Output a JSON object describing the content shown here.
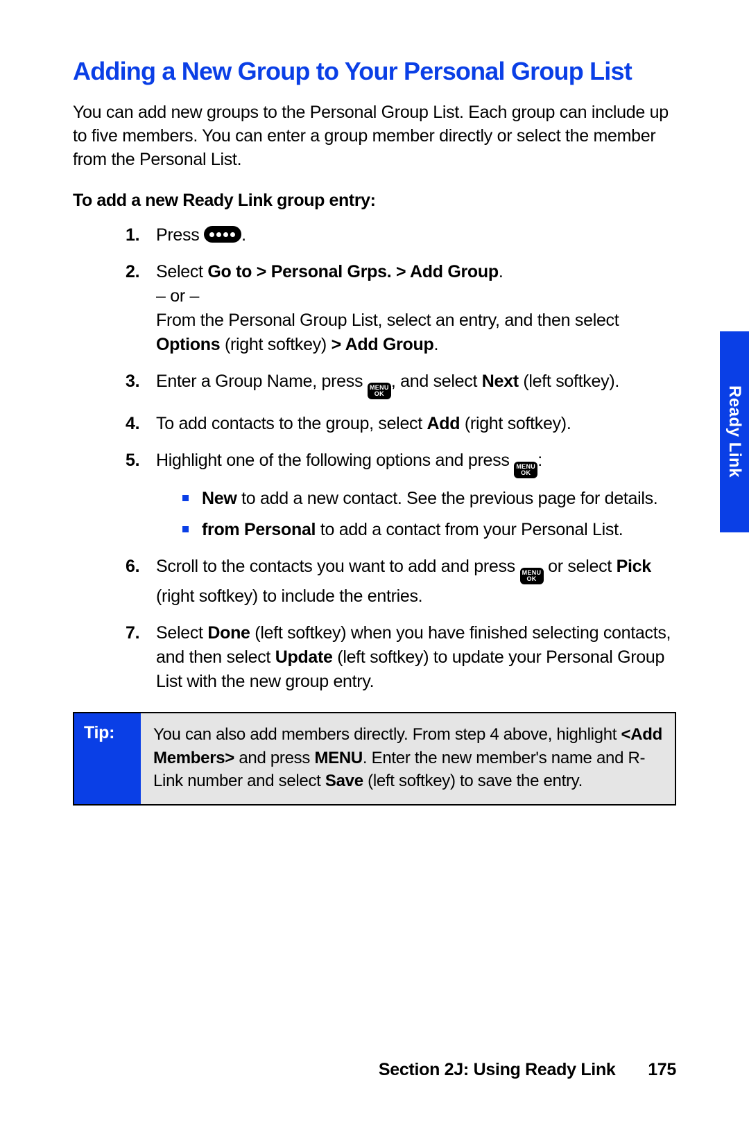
{
  "title": "Adding a New Group to Your Personal Group List",
  "intro": "You can add new groups to the Personal Group List. Each group can include up to five members. You can enter a group member directly or select the member from the Personal List.",
  "subhead": "To add a new Ready Link group entry:",
  "steps": {
    "s1_a": "Press ",
    "s1_b": ".",
    "s2_a": "Select ",
    "s2_b": "Go to > Personal Grps. > Add Group",
    "s2_c": ".",
    "s2_or": "– or –",
    "s2_d1": "From the Personal Group List, select an entry, and then select ",
    "s2_d2": "Options",
    "s2_d3": " (right softkey) ",
    "s2_d4": "> Add Group",
    "s2_d5": ".",
    "s3_a": "Enter a Group Name, press ",
    "s3_b": ", and select ",
    "s3_c": "Next",
    "s3_d": " (left softkey).",
    "s4_a": "To add contacts to the group, select ",
    "s4_b": "Add",
    "s4_c": " (right softkey).",
    "s5_a": "Highlight one of the following options and press ",
    "s5_b": ":",
    "s5_opt1_a": "New",
    "s5_opt1_b": " to add a new contact. See the previous page for details.",
    "s5_opt2_a": "from Personal",
    "s5_opt2_b": " to add a contact from your Personal List.",
    "s6_a": "Scroll to the contacts you want to add and press ",
    "s6_b": " or select ",
    "s6_c": "Pick",
    "s6_d": " (right softkey) to include the entries.",
    "s7_a": "Select ",
    "s7_b": "Done",
    "s7_c": " (left softkey) when you have finished selecting contacts, and then select ",
    "s7_d": "Update",
    "s7_e": " (left softkey) to update your Personal Group List with the new group entry."
  },
  "tip": {
    "label": "Tip:",
    "t1": "You can also add members directly. From step 4 above, highlight ",
    "t2": "<Add Members>",
    "t3": " and press ",
    "t4": "MENU",
    "t5": ". Enter the new member's name and R-Link number and select ",
    "t6": "Save",
    "t7": " (left softkey) to save the entry."
  },
  "side_tab": "Ready Link",
  "footer": {
    "section": "Section 2J: Using Ready Link",
    "page": "175"
  },
  "icons": {
    "menu_top": "MENU",
    "menu_bot": "OK"
  }
}
